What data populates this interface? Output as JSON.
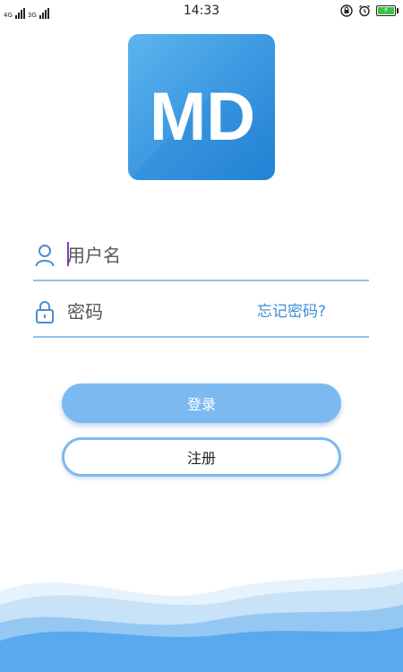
{
  "status_bar": {
    "network_label_1": "4G",
    "network_label_2": "3G",
    "time": "14:33",
    "icons": [
      "lock-rotation-icon",
      "alarm-icon",
      "battery-charging-icon"
    ]
  },
  "logo": {
    "text": "MD"
  },
  "login_form": {
    "username_placeholder": "用户名",
    "password_placeholder": "密码",
    "forgot_password": "忘记密码?",
    "login_button": "登录",
    "register_button": "注册"
  },
  "colors": {
    "accent": "#7cb9f0",
    "link": "#3d8fd6",
    "underline": "#8ec3ea",
    "wave": "#5aa9ef"
  }
}
